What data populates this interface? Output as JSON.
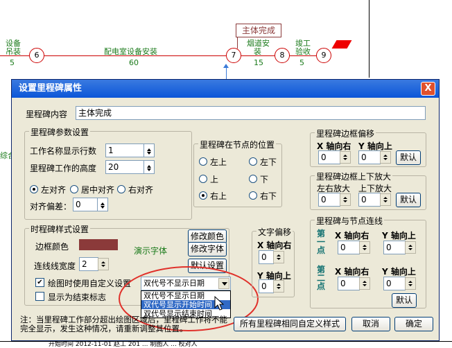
{
  "background": {
    "left_labels": [
      "设备",
      "吊装"
    ],
    "left_value": "5",
    "tasks": [
      {
        "label": "配电室设备安装",
        "value": "60"
      },
      {
        "label": "烟道安装",
        "value": "15"
      },
      {
        "label": "竣工验收",
        "value": "5"
      }
    ],
    "nodes": [
      "6",
      "7",
      "8",
      "9"
    ],
    "milestone_label": "主体完成",
    "side_label": "综合",
    "bottom_strip": "开始时间  2012-11-01  赵工  201  ...  制图人  ...  校对人"
  },
  "dialog": {
    "title": "设置里程碑属性",
    "close_glyph": "X",
    "content_label": "里程碑内容",
    "content_value": "主体完成",
    "params": {
      "title": "里程碑参数设置",
      "rows_label": "工作名称显示行数",
      "rows_value": "1",
      "height_label": "里程碑工作的高度",
      "height_value": "20",
      "align_left": "左对齐",
      "align_center": "居中对齐",
      "align_right": "右对齐",
      "offset_label": "对齐偏差：",
      "offset_value": "0"
    },
    "position": {
      "title": "里程碑在节点的位置",
      "options": [
        "左上",
        "左下",
        "上",
        "下",
        "右上",
        "右下"
      ],
      "selected": "右上"
    },
    "style": {
      "title": "时程碑样式设置",
      "border_color_label": "边框颜色",
      "border_color": "#8b3a3a",
      "demo_font": "演示字体",
      "line_width_label": "连线线宽度",
      "line_width_value": "2",
      "btn_color": "修改颜色",
      "btn_font": "修改字体",
      "btn_default": "默认设置",
      "custom_label": "绘图时使用自定义设置",
      "end_flag_label": "显示为结束标志"
    },
    "dropdown": {
      "value": "双代号不显示日期",
      "options": [
        "双代号不显示日期",
        "双代号显示开始时间",
        "双代号显示结束时间"
      ],
      "highlighted": "双代号显示开始时间"
    },
    "text_offset": {
      "title": "文字偏移",
      "x_label": "X 轴向右",
      "x_value": "0",
      "y_label": "Y 轴向上",
      "y_value": "0"
    },
    "border_offset": {
      "title": "里程碑边框偏移",
      "x_label": "X 轴向右",
      "y_label": "Y 轴向上",
      "x_value": "0",
      "y_value": "0",
      "btn": "默认"
    },
    "border_zoom": {
      "title": "里程碑边框上下放大",
      "l_label": "左右放大",
      "u_label": "上下放大",
      "l_value": "0",
      "u_value": "0",
      "btn": "默认"
    },
    "connect": {
      "title": "里程碑与节点连线",
      "p1": "第一点",
      "p2": "第二点",
      "x_label": "X 轴向右",
      "y_label": "Y 轴向上",
      "values": [
        "0",
        "0",
        "0",
        "0"
      ],
      "btn": "默认"
    },
    "note": "注：当里程碑工作部分超出绘图区域后，里程碑工作将不能完全显示，发生这种情况，请重新调整其位置。",
    "btn_all": "所有里程碑相同自定义样式",
    "btn_cancel": "取消",
    "btn_ok": "确定"
  },
  "colors": {
    "title_bar": "#0b56d8",
    "dialog_bg": "#ece9d8",
    "arrow_red": "#cc0000",
    "annotation": "#e0302a"
  }
}
